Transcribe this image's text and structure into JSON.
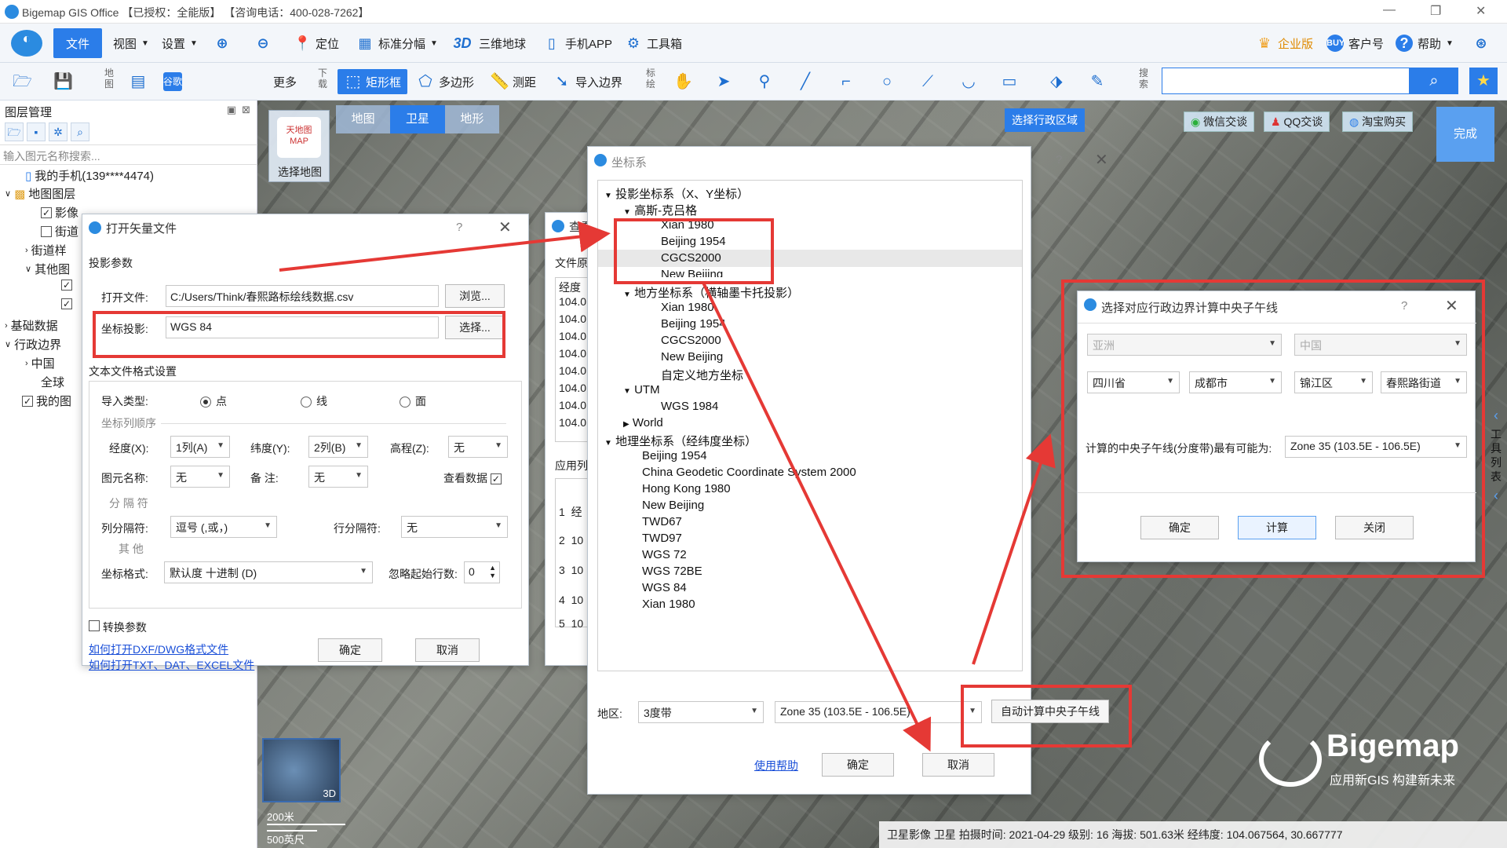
{
  "title": "Bigemap GIS Office 【已授权：全能版】 【咨询电话：400-028-7262】",
  "menu": {
    "file": "文件",
    "view": "视图",
    "settings": "设置",
    "locate": "定位",
    "standard_sheet": "标准分幅",
    "earth3d": "三维地球",
    "mobile": "手机APP",
    "toolbox": "工具箱",
    "enterprise": "企业版",
    "customer": "客户号",
    "help": "帮助"
  },
  "toolbar2": {
    "map_label": "地图",
    "more": "更多",
    "download_label": "下载",
    "rect": "矩形框",
    "polygon": "多边形",
    "measure": "测距",
    "import_boundary": "导入边界",
    "mark_label": "标绘",
    "search_label": "搜索",
    "search_value": ""
  },
  "left_panel": {
    "title": "图层管理",
    "search_placeholder": "输入图元名称搜索...",
    "items": {
      "phone": "我的手机(139****4474)",
      "map_layers": "地图图层",
      "imagery": "影像",
      "street": "街道",
      "street_style": "街道样",
      "other_layers": "其他图",
      "basic_data": "基础数据",
      "admin": "行政边界",
      "china": "中国",
      "global": "全球",
      "my_layers": "我的图"
    }
  },
  "map": {
    "tabs": [
      "地图",
      "卫星",
      "地形"
    ],
    "active_tab": "卫星",
    "select_map": "选择地图",
    "select_region": "选择行政区域",
    "wechat": "微信交谈",
    "qq": "QQ交谈",
    "taobao": "淘宝购买",
    "done": "完成",
    "toolbar_side": "工具列表",
    "scale_1": "200米",
    "scale_2": "500英尺",
    "brand": "Bigemap",
    "slogan": "应用新GIS  构建新未来",
    "status": "卫星影像 卫星  拍摄时间: 2021-04-29  级别: 16  海拔: 501.63米  经纬度: 104.067564, 30.667777"
  },
  "open_vector": {
    "title": "打开矢量文件",
    "proj_params": "投影参数",
    "open_file_label": "打开文件:",
    "open_file_value": "C:/Users/Think/春熙路标绘线数据.csv",
    "browse": "浏览...",
    "coord_label": "坐标投影:",
    "coord_value": "WGS 84",
    "choose": "选择...",
    "text_format": "文本文件格式设置",
    "import_type": "导入类型:",
    "type_point": "点",
    "type_line": "线",
    "type_polygon": "面",
    "col_order": "坐标列顺序",
    "lon_label": "经度(X):",
    "lon_value": "1列(A)",
    "lat_label": "纬度(Y):",
    "lat_value": "2列(B)",
    "alt_label": "高程(Z):",
    "alt_value": "无",
    "name_label": "图元名称:",
    "name_value": "无",
    "note_label": "备  注:",
    "note_value": "无",
    "view_data": "查看数据",
    "separator": "分 隔 符",
    "col_sep_label": "列分隔符:",
    "col_sep_value": "逗号 (,或，)",
    "row_sep_label": "行分隔符:",
    "row_sep_value": "无",
    "other": "其 他",
    "coord_fmt_label": "坐标格式:",
    "coord_fmt_value": "默认度 十进制 (D)",
    "skip_label": "忽略起始行数:",
    "skip_value": "0",
    "convert": "转换参数",
    "link1": "如何打开DXF/DWG格式文件",
    "link2": "如何打开TXT、DAT、EXCEL文件",
    "ok": "确定",
    "cancel": "取消"
  },
  "view_dialog": {
    "title": "查看",
    "file_col": "文件原",
    "lon_header": "经度",
    "values": [
      "104.0",
      "104.0",
      "104.0",
      "104.0",
      "104.0",
      "104.0",
      "104.0",
      "104.0"
    ],
    "apply_col": "应用列",
    "rows": [
      "1",
      "2",
      "3",
      "4",
      "5"
    ],
    "row_vals": [
      "经",
      "10",
      "10",
      "10",
      "10"
    ]
  },
  "coord_dialog": {
    "title": "坐标系",
    "proj_root": "投影坐标系（X、Y坐标）",
    "gauss": "高斯-克吕格",
    "gauss_items": [
      "Xian 1980",
      "Beijing 1954",
      "CGCS2000",
      "New Beijing"
    ],
    "local": "地方坐标系（横轴墨卡托投影）",
    "local_items": [
      "Xian 1980",
      "Beijing 1954",
      "CGCS2000",
      "New Beijing",
      "自定义地方坐标"
    ],
    "utm": "UTM",
    "utm_items": [
      "WGS 1984"
    ],
    "world": "World",
    "geo_root": "地理坐标系（经纬度坐标）",
    "geo_items": [
      "Beijing 1954",
      "China Geodetic Coordinate System 2000",
      "Hong Kong 1980",
      "New Beijing",
      "TWD67",
      "TWD97",
      "WGS 72",
      "WGS 72BE",
      "WGS 84",
      "Xian 1980"
    ],
    "region_label": "地区:",
    "band_value": "3度带",
    "zone_value": "Zone 35 (103.5E - 106.5E)",
    "auto_calc": "自动计算中央子午线",
    "help": "使用帮助",
    "ok": "确定",
    "cancel": "取消"
  },
  "meridian_dialog": {
    "title": "选择对应行政边界计算中央子午线",
    "continent": "亚洲",
    "country": "中国",
    "province": "四川省",
    "city": "成都市",
    "district": "锦江区",
    "street": "春熙路街道",
    "result_label": "计算的中央子午线(分度带)最有可能为:",
    "result_value": "Zone 35 (103.5E - 106.5E)",
    "ok": "确定",
    "calc": "计算",
    "close": "关闭"
  },
  "colors": {
    "accent": "#2b7de9",
    "annotation": "#e53935"
  }
}
